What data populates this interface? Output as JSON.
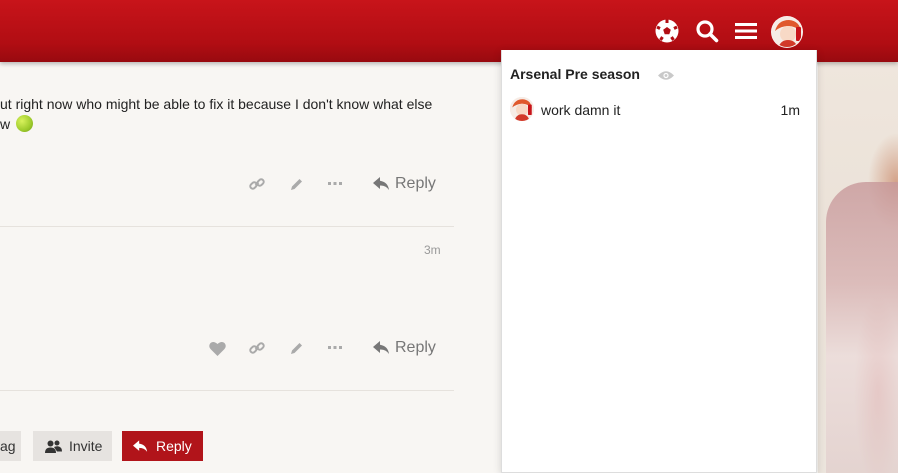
{
  "post": {
    "line1": "ut right now who might be able to fix it because I don't know what else",
    "line2": "w"
  },
  "post2": {
    "time": "3m"
  },
  "actions": {
    "reply_label": "Reply"
  },
  "footer": {
    "flag_label": "ag",
    "invite_label": "Invite",
    "reply_label": "Reply"
  },
  "dropdown": {
    "title": "Arsenal Pre season",
    "items": [
      {
        "text": "work damn it",
        "time": "1m"
      }
    ]
  },
  "colors": {
    "header": "#b10d13",
    "reply_button": "#b1141a",
    "panel_bg": "#ffffff",
    "page_bg": "#f8f6f3"
  },
  "icons": {
    "header": [
      "soccer-ball-icon",
      "search-icon",
      "hamburger-menu-icon",
      "user-avatar"
    ],
    "post_actions": [
      "like-heart-icon",
      "link-icon",
      "edit-pencil-icon",
      "more-dots-icon",
      "reply-arrow-icon"
    ]
  }
}
